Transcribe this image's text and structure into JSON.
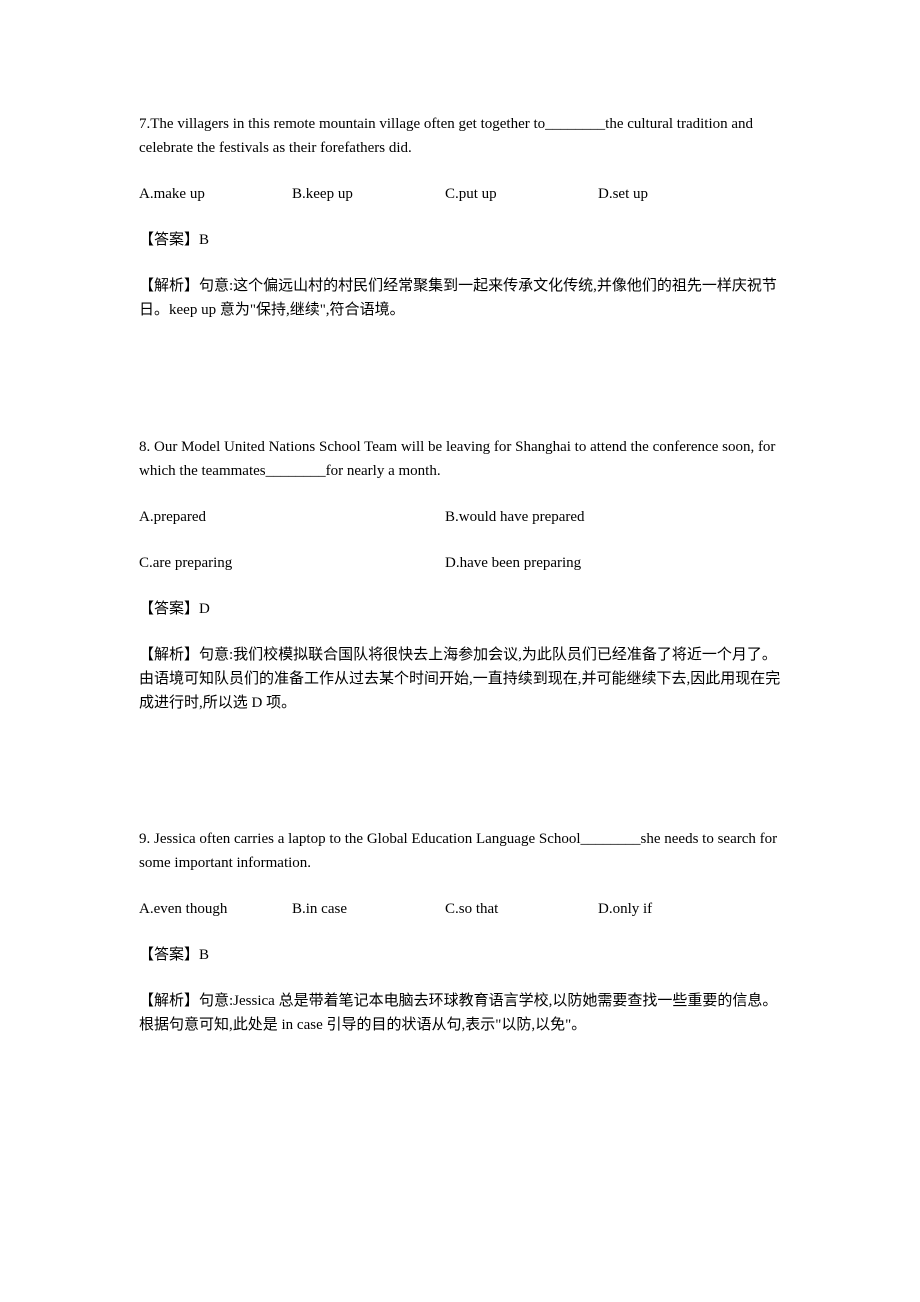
{
  "questions": [
    {
      "number": "7.",
      "stem_before": "The villagers in this remote mountain village often get together to",
      "blank": "________",
      "stem_after": "the cultural tradition and celebrate the festivals as their forefathers did.",
      "options": [
        {
          "letter": "A",
          "text": "A.make up"
        },
        {
          "letter": "B",
          "text": "B.keep up"
        },
        {
          "letter": "C",
          "text": "C.put up"
        },
        {
          "letter": "D",
          "text": "D.set up"
        }
      ],
      "answer_tag": "【答案】",
      "answer": "B",
      "analysis_tag": "【解析】",
      "analysis": "句意:这个偏远山村的村民们经常聚集到一起来传承文化传统,并像他们的祖先一样庆祝节日。keep up 意为\"保持,继续\",符合语境。"
    },
    {
      "number": "8.",
      "stem_before": " Our Model United Nations School Team will be leaving for Shanghai to attend the conference soon, for which the teammates",
      "blank": "________",
      "stem_after": "for nearly a month.",
      "options": [
        {
          "letter": "A",
          "text": "A.prepared"
        },
        {
          "letter": "B",
          "text": "B.would have prepared"
        },
        {
          "letter": "C",
          "text": "C.are preparing"
        },
        {
          "letter": "D",
          "text": "D.have been preparing"
        }
      ],
      "answer_tag": "【答案】",
      "answer": "D",
      "analysis_tag": "【解析】",
      "analysis": "句意:我们校模拟联合国队将很快去上海参加会议,为此队员们已经准备了将近一个月了。由语境可知队员们的准备工作从过去某个时间开始,一直持续到现在,并可能继续下去,因此用现在完成进行时,所以选 D 项。"
    },
    {
      "number": "9.",
      "stem_before": " Jessica often carries a laptop to the Global Education Language School",
      "blank": "________",
      "stem_after": "she needs to search for some important information.",
      "options": [
        {
          "letter": "A",
          "text": "A.even though"
        },
        {
          "letter": "B",
          "text": "B.in case"
        },
        {
          "letter": "C",
          "text": "C.so that"
        },
        {
          "letter": "D",
          "text": "D.only if"
        }
      ],
      "answer_tag": "【答案】",
      "answer": "B",
      "analysis_tag": "【解析】",
      "analysis": "句意:Jessica 总是带着笔记本电脑去环球教育语言学校,以防她需要查找一些重要的信息。根据句意可知,此处是 in case 引导的目的状语从句,表示\"以防,以免\"。"
    }
  ]
}
